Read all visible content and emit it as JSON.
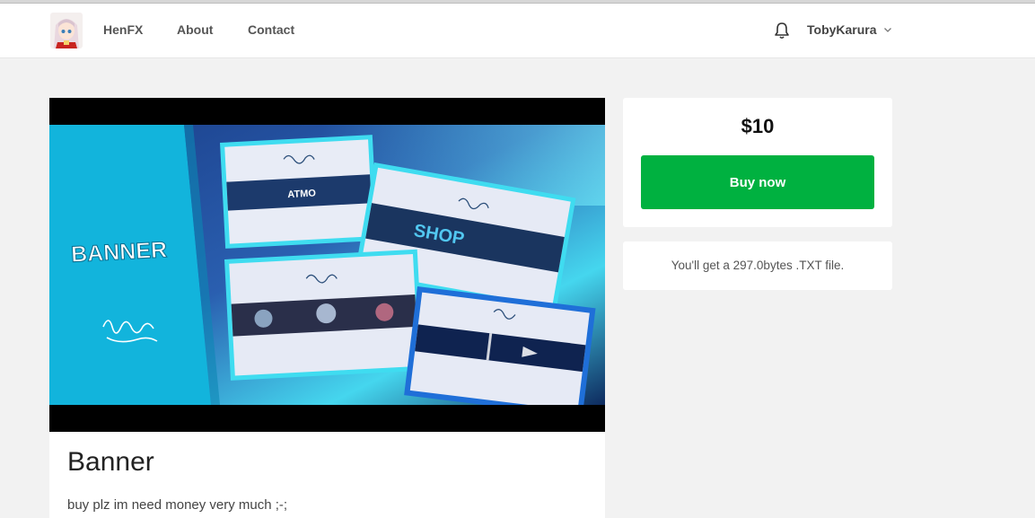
{
  "header": {
    "nav": [
      {
        "label": "HenFX"
      },
      {
        "label": "About"
      },
      {
        "label": "Contact"
      }
    ],
    "user": {
      "name": "TobyKarura"
    }
  },
  "product": {
    "title": "Banner",
    "description": "buy plz im need money very much ;-;",
    "cover": {
      "side_text": "BANNER",
      "banner_texts": [
        "ATMO",
        "SHOP"
      ]
    }
  },
  "purchase": {
    "price": "$10",
    "buy_label": "Buy now",
    "file_info": "You'll get a 297.0bytes .TXT file."
  },
  "colors": {
    "buy_button": "#00b140",
    "cover_blue": "#12b4dc",
    "cover_cyan": "#3ee3f2"
  },
  "icons": {
    "notifications": "bell-icon",
    "user_menu": "chevron-down-icon"
  }
}
